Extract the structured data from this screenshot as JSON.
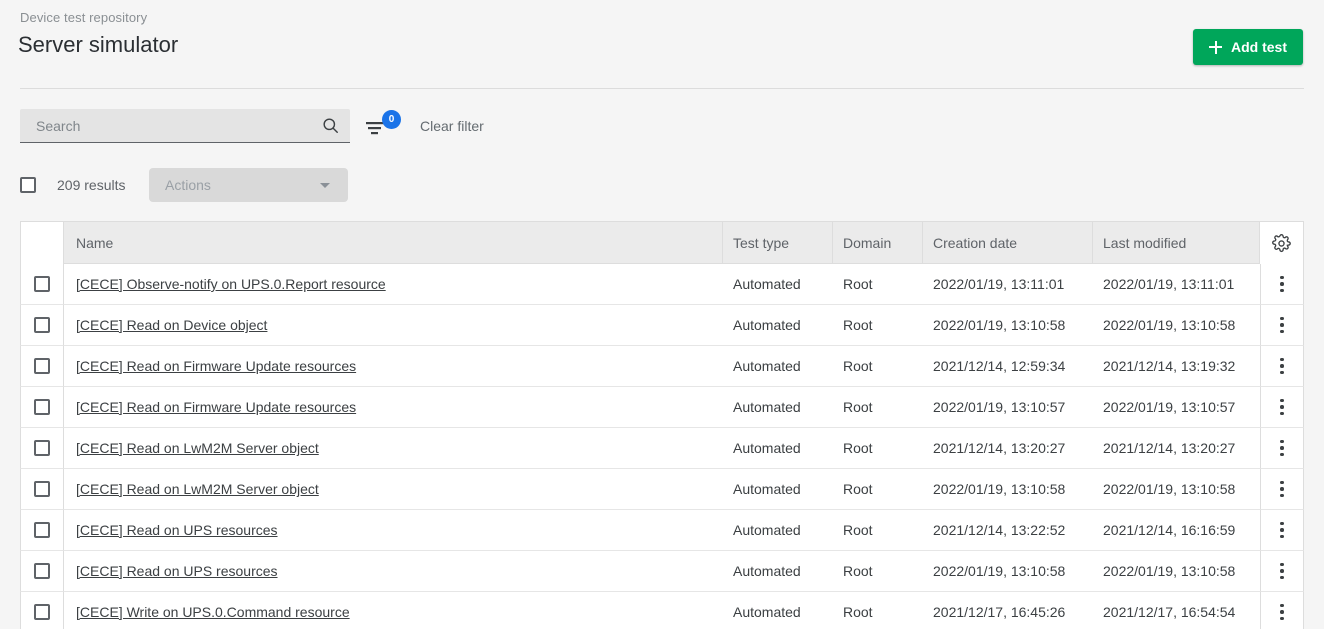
{
  "header": {
    "breadcrumb": "Device test repository",
    "title": "Server simulator",
    "add_button": "Add test"
  },
  "filter_bar": {
    "search_placeholder": "Search",
    "search_value": "",
    "filter_badge_count": "0",
    "clear_filter": "Clear filter"
  },
  "results_bar": {
    "count_label": "209 results",
    "actions_label": "Actions"
  },
  "table": {
    "columns": {
      "name": "Name",
      "test_type": "Test type",
      "domain": "Domain",
      "creation_date": "Creation date",
      "last_modified": "Last modified",
      "settings_icon": "gear-icon"
    },
    "rows": [
      {
        "name": "[CECE] Observe-notify on UPS.0.Report resource",
        "test_type": "Automated",
        "domain": "Root",
        "creation_date": "2022/01/19, 13:11:01",
        "last_modified": "2022/01/19, 13:11:01"
      },
      {
        "name": "[CECE] Read on Device object",
        "test_type": "Automated",
        "domain": "Root",
        "creation_date": "2022/01/19, 13:10:58",
        "last_modified": "2022/01/19, 13:10:58"
      },
      {
        "name": "[CECE] Read on Firmware Update resources",
        "test_type": "Automated",
        "domain": "Root",
        "creation_date": "2021/12/14, 12:59:34",
        "last_modified": "2021/12/14, 13:19:32"
      },
      {
        "name": "[CECE] Read on Firmware Update resources",
        "test_type": "Automated",
        "domain": "Root",
        "creation_date": "2022/01/19, 13:10:57",
        "last_modified": "2022/01/19, 13:10:57"
      },
      {
        "name": "[CECE] Read on LwM2M Server object",
        "test_type": "Automated",
        "domain": "Root",
        "creation_date": "2021/12/14, 13:20:27",
        "last_modified": "2021/12/14, 13:20:27"
      },
      {
        "name": "[CECE] Read on LwM2M Server object",
        "test_type": "Automated",
        "domain": "Root",
        "creation_date": "2022/01/19, 13:10:58",
        "last_modified": "2022/01/19, 13:10:58"
      },
      {
        "name": "[CECE] Read on UPS resources",
        "test_type": "Automated",
        "domain": "Root",
        "creation_date": "2021/12/14, 13:22:52",
        "last_modified": "2021/12/14, 16:16:59"
      },
      {
        "name": "[CECE] Read on UPS resources",
        "test_type": "Automated",
        "domain": "Root",
        "creation_date": "2022/01/19, 13:10:58",
        "last_modified": "2022/01/19, 13:10:58"
      },
      {
        "name": "[CECE] Write on UPS.0.Command resource",
        "test_type": "Automated",
        "domain": "Root",
        "creation_date": "2021/12/17, 16:45:26",
        "last_modified": "2021/12/17, 16:54:54"
      }
    ]
  },
  "colors": {
    "accent_green": "#00a65a",
    "badge_blue": "#1a73e8",
    "page_background": "#f5f5f5",
    "table_header": "#ebebeb"
  }
}
